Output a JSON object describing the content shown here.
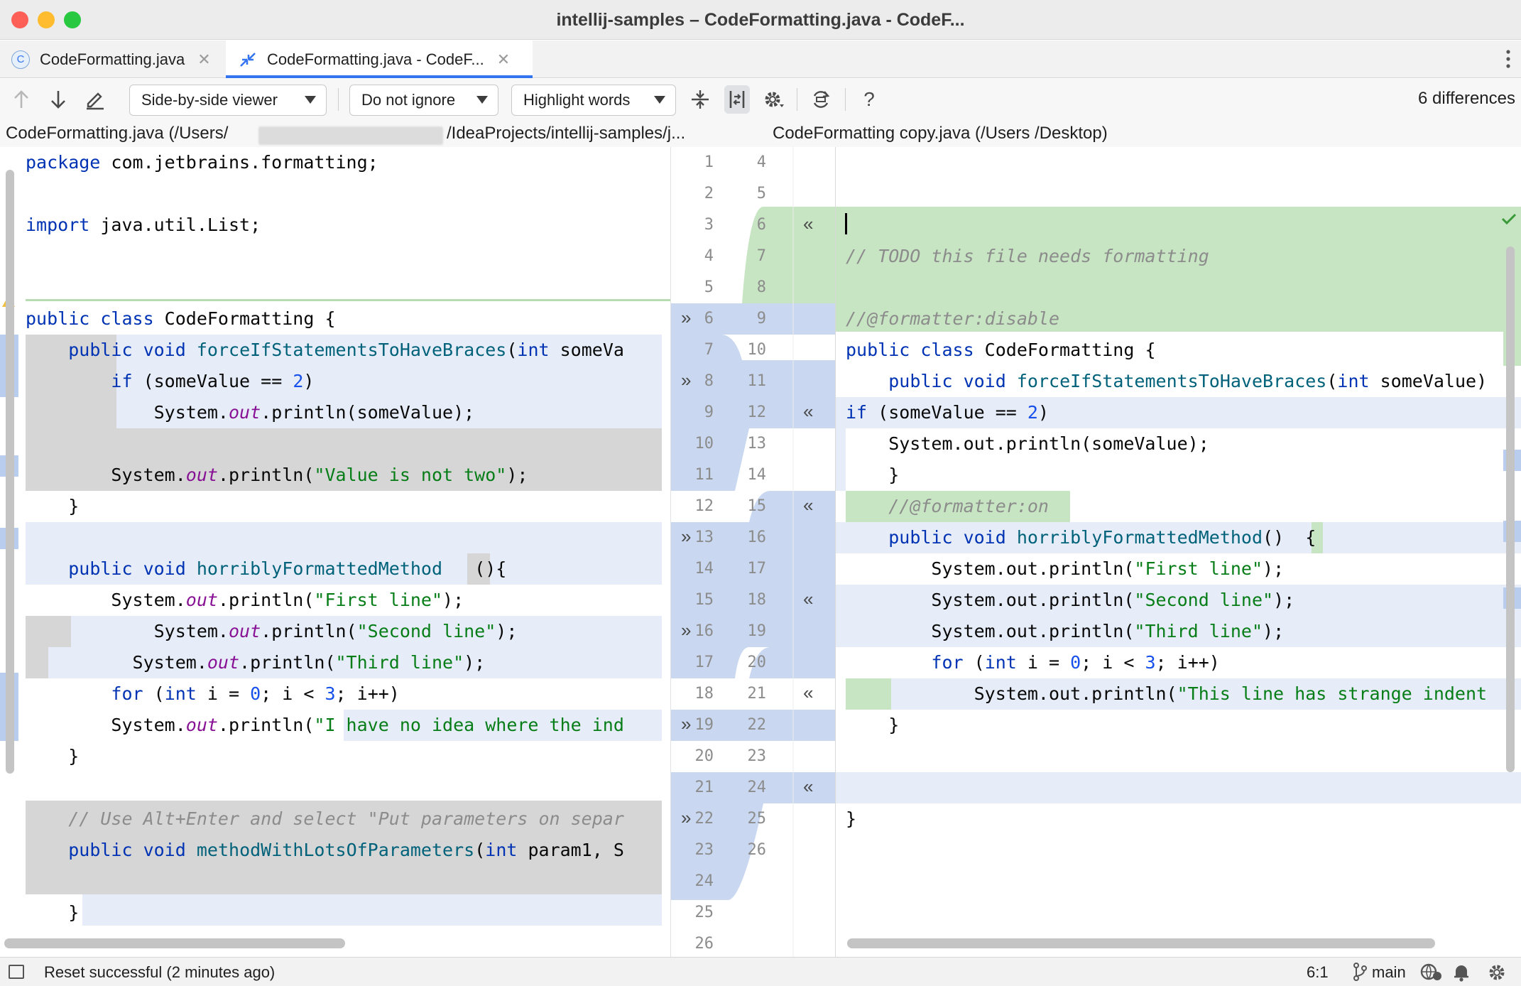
{
  "window": {
    "title": "intellij-samples – CodeFormatting.java - CodeF..."
  },
  "tabs": [
    {
      "label": "CodeFormatting.java",
      "icon": "java-class-icon",
      "close": "✕"
    },
    {
      "label": "CodeFormatting.java - CodeF...",
      "icon": "diff-icon",
      "close": "✕",
      "active": true
    }
  ],
  "toolbar": {
    "viewer": "Side-by-side viewer",
    "ignore": "Do not ignore",
    "highlight": "Highlight words",
    "help": "?",
    "differences": "6 differences"
  },
  "paths": {
    "left_a": "CodeFormatting.java (/Users/",
    "left_b": "/IdeaProjects/intellij-samples/j...",
    "right": "CodeFormatting copy.java (/Users /Desktop)"
  },
  "gutter": {
    "left_numbers": [
      "1",
      "2",
      "3",
      "4",
      "5",
      "6",
      "7",
      "8",
      "9",
      "10",
      "11",
      "12",
      "13",
      "14",
      "15",
      "16",
      "17",
      "18",
      "19",
      "20",
      "21",
      "22",
      "23",
      "24",
      "25",
      "26"
    ],
    "right_numbers": [
      "4",
      "5",
      "6",
      "7",
      "8",
      "9",
      "10",
      "11",
      "12",
      "13",
      "14",
      "15",
      "16",
      "17",
      "18",
      "19",
      "20",
      "21",
      "22",
      "23",
      "24",
      "25",
      "26"
    ],
    "apply_right": "»",
    "apply_left": "«"
  },
  "left_code": [
    {
      "parts": [
        {
          "t": "package",
          "c": "k"
        },
        {
          "t": " com.jetbrains.formatting;"
        }
      ]
    },
    {
      "parts": []
    },
    {
      "parts": [
        {
          "t": "import",
          "c": "k"
        },
        {
          "t": " java.util.List;"
        }
      ]
    },
    {
      "parts": []
    },
    {
      "parts": []
    },
    {
      "parts": [
        {
          "t": "public class",
          "c": "k"
        },
        {
          "t": " CodeFormatting {"
        }
      ]
    },
    {
      "parts": [
        {
          "t": "    "
        },
        {
          "t": "public void",
          "c": "k"
        },
        {
          "t": " "
        },
        {
          "t": "forceIfStatementsToHaveBraces",
          "c": "m"
        },
        {
          "t": "("
        },
        {
          "t": "int",
          "c": "k"
        },
        {
          "t": " someVa"
        }
      ]
    },
    {
      "parts": [
        {
          "t": "        "
        },
        {
          "t": "if",
          "c": "k"
        },
        {
          "t": " (someValue == "
        },
        {
          "t": "2",
          "c": "n"
        },
        {
          "t": ")"
        }
      ]
    },
    {
      "parts": [
        {
          "t": "            System."
        },
        {
          "t": "out",
          "c": "i"
        },
        {
          "t": ".println(someValue);"
        }
      ]
    },
    {
      "parts": []
    },
    {
      "parts": [
        {
          "t": "        System."
        },
        {
          "t": "out",
          "c": "i"
        },
        {
          "t": ".println("
        },
        {
          "t": "\"Value is not two\"",
          "c": "s"
        },
        {
          "t": ");"
        }
      ]
    },
    {
      "parts": [
        {
          "t": "    }"
        }
      ]
    },
    {
      "parts": []
    },
    {
      "parts": [
        {
          "t": "    "
        },
        {
          "t": "public void",
          "c": "k"
        },
        {
          "t": " "
        },
        {
          "t": "horriblyFormattedMethod",
          "c": "m"
        },
        {
          "t": "   (){"
        }
      ]
    },
    {
      "parts": [
        {
          "t": "        System."
        },
        {
          "t": "out",
          "c": "i"
        },
        {
          "t": ".println("
        },
        {
          "t": "\"First line\"",
          "c": "s"
        },
        {
          "t": ");"
        }
      ]
    },
    {
      "parts": [
        {
          "t": "            System."
        },
        {
          "t": "out",
          "c": "i"
        },
        {
          "t": ".println("
        },
        {
          "t": "\"Second line\"",
          "c": "s"
        },
        {
          "t": ");"
        }
      ]
    },
    {
      "parts": [
        {
          "t": "          System."
        },
        {
          "t": "out",
          "c": "i"
        },
        {
          "t": ".println("
        },
        {
          "t": "\"Third line\"",
          "c": "s"
        },
        {
          "t": ");"
        }
      ]
    },
    {
      "parts": [
        {
          "t": "        "
        },
        {
          "t": "for",
          "c": "k"
        },
        {
          "t": " ("
        },
        {
          "t": "int",
          "c": "k"
        },
        {
          "t": " i = "
        },
        {
          "t": "0",
          "c": "n"
        },
        {
          "t": "; i < "
        },
        {
          "t": "3",
          "c": "n"
        },
        {
          "t": "; i++)"
        }
      ]
    },
    {
      "parts": [
        {
          "t": "        System."
        },
        {
          "t": "out",
          "c": "i"
        },
        {
          "t": ".println("
        },
        {
          "t": "\"I have no idea where the ind",
          "c": "s"
        }
      ]
    },
    {
      "parts": [
        {
          "t": "    }"
        }
      ]
    },
    {
      "parts": []
    },
    {
      "parts": [
        {
          "t": "    "
        },
        {
          "t": "// Use Alt+Enter and select \"Put parameters on separ",
          "c": "c"
        }
      ]
    },
    {
      "parts": [
        {
          "t": "    "
        },
        {
          "t": "public void",
          "c": "k"
        },
        {
          "t": " "
        },
        {
          "t": "methodWithLotsOfParameters",
          "c": "m"
        },
        {
          "t": "("
        },
        {
          "t": "int",
          "c": "k"
        },
        {
          "t": " param1, S"
        }
      ]
    },
    {
      "parts": []
    },
    {
      "parts": [
        {
          "t": "    }"
        }
      ]
    }
  ],
  "right_code": [
    {
      "parts": []
    },
    {
      "parts": []
    },
    {
      "parts": []
    },
    {
      "parts": [
        {
          "t": "// TODO this file needs formatting",
          "c": "c"
        }
      ]
    },
    {
      "parts": []
    },
    {
      "parts": [
        {
          "t": "//@formatter:disable",
          "c": "c"
        }
      ]
    },
    {
      "parts": [
        {
          "t": "public class",
          "c": "k"
        },
        {
          "t": " CodeFormatting {"
        }
      ]
    },
    {
      "parts": [
        {
          "t": "    "
        },
        {
          "t": "public void",
          "c": "k"
        },
        {
          "t": " "
        },
        {
          "t": "forceIfStatementsToHaveBraces",
          "c": "m"
        },
        {
          "t": "("
        },
        {
          "t": "int",
          "c": "k"
        },
        {
          "t": " someValue)"
        }
      ]
    },
    {
      "parts": [
        {
          "t": "if",
          "c": "k"
        },
        {
          "t": " (someValue == "
        },
        {
          "t": "2",
          "c": "n"
        },
        {
          "t": ")"
        }
      ]
    },
    {
      "parts": [
        {
          "t": "    System.out.println(someValue);"
        }
      ]
    },
    {
      "parts": [
        {
          "t": "    }"
        }
      ]
    },
    {
      "parts": [
        {
          "t": "    "
        },
        {
          "t": "//@formatter:on",
          "c": "c"
        }
      ]
    },
    {
      "parts": [
        {
          "t": "    "
        },
        {
          "t": "public void",
          "c": "k"
        },
        {
          "t": " "
        },
        {
          "t": "horriblyFormattedMethod",
          "c": "m"
        },
        {
          "t": "()  {"
        }
      ]
    },
    {
      "parts": [
        {
          "t": "        System.out.println("
        },
        {
          "t": "\"First line\"",
          "c": "s"
        },
        {
          "t": ");"
        }
      ]
    },
    {
      "parts": [
        {
          "t": "        System.out.println("
        },
        {
          "t": "\"Second line\"",
          "c": "s"
        },
        {
          "t": ");"
        }
      ]
    },
    {
      "parts": [
        {
          "t": "        System.out.println("
        },
        {
          "t": "\"Third line\"",
          "c": "s"
        },
        {
          "t": ");"
        }
      ]
    },
    {
      "parts": [
        {
          "t": "        "
        },
        {
          "t": "for",
          "c": "k"
        },
        {
          "t": " ("
        },
        {
          "t": "int",
          "c": "k"
        },
        {
          "t": " i = "
        },
        {
          "t": "0",
          "c": "n"
        },
        {
          "t": "; i < "
        },
        {
          "t": "3",
          "c": "n"
        },
        {
          "t": "; i++)"
        }
      ]
    },
    {
      "parts": [
        {
          "t": "            System.out.println("
        },
        {
          "t": "\"This line has strange indent",
          "c": "s"
        }
      ]
    },
    {
      "parts": [
        {
          "t": "    }"
        }
      ]
    },
    {
      "parts": []
    },
    {
      "parts": []
    },
    {
      "parts": [
        {
          "t": "}"
        }
      ]
    }
  ],
  "status": {
    "message": "Reset successful (2 minutes ago)",
    "position": "6:1",
    "branch": "main"
  },
  "colors": {
    "inserted": "#c7e5c3",
    "modified": "#e6edf8",
    "modified_gutter": "#c9d8f0",
    "removed_grey": "#d6d6d6",
    "accent": "#3574f0"
  }
}
